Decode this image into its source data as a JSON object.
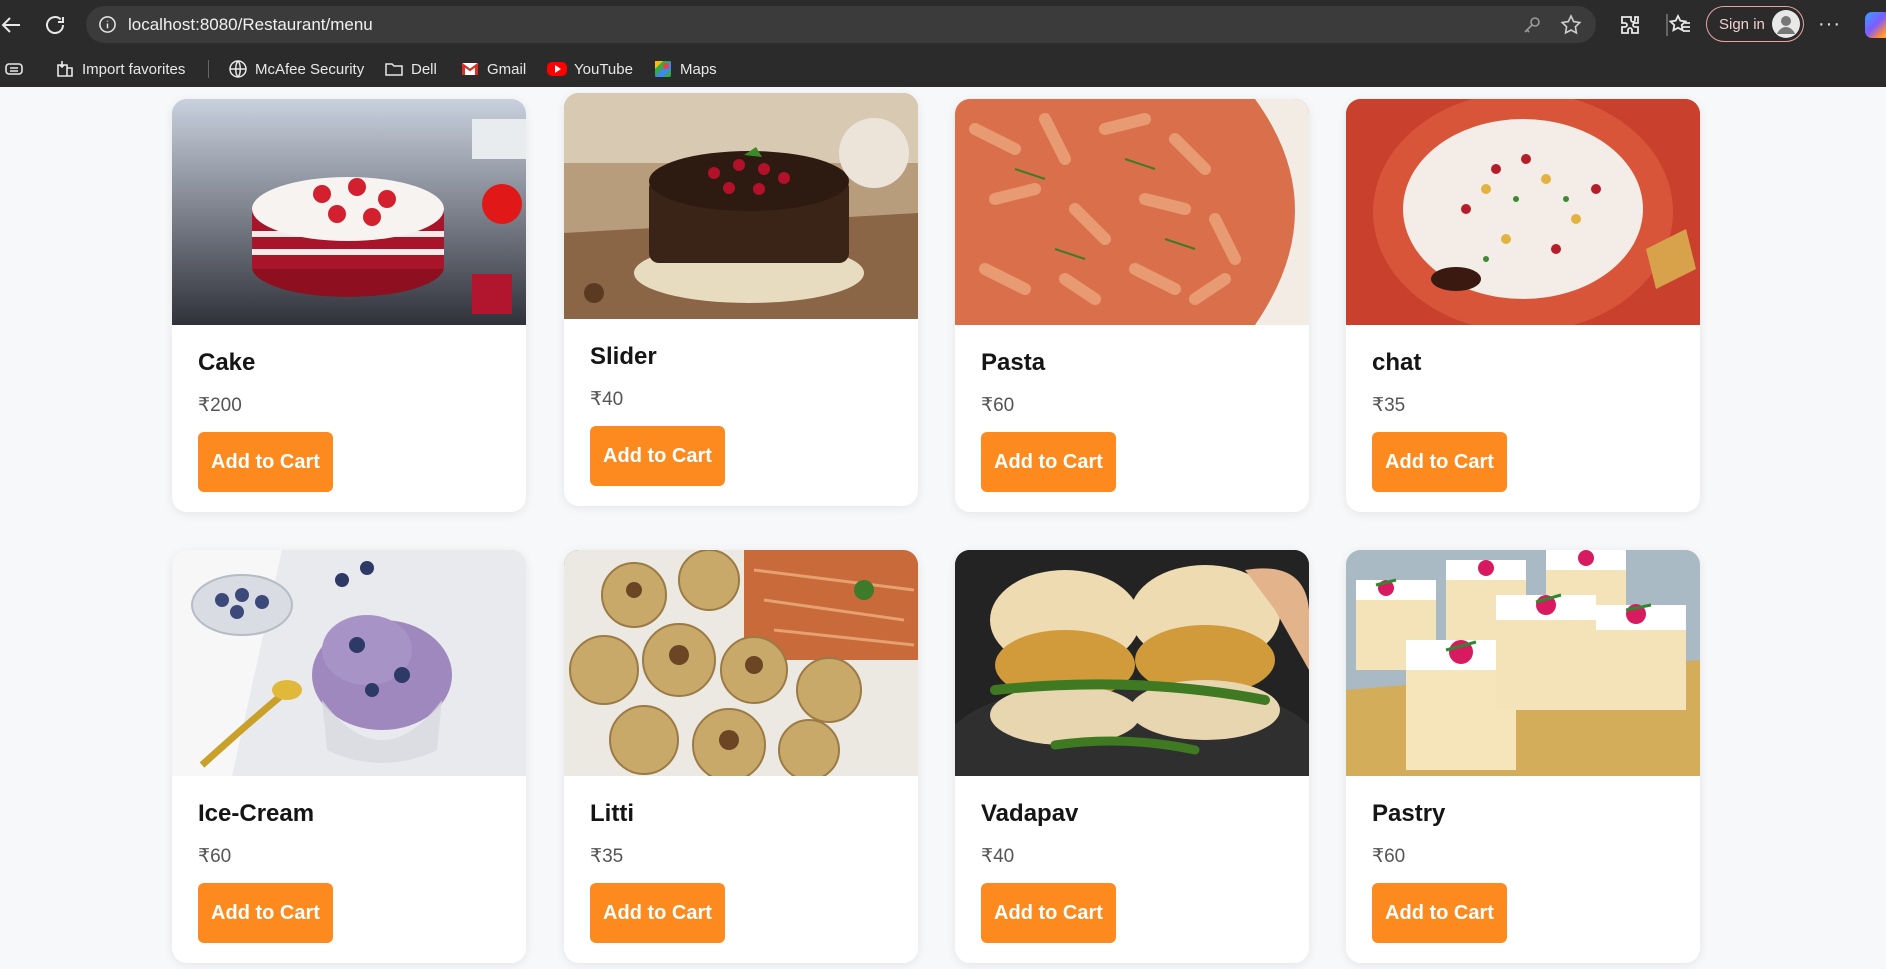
{
  "browser": {
    "url": "localhost:8080/Restaurant/menu",
    "signin_label": "Sign in",
    "more_label": "···",
    "bookmarks": [
      {
        "label": "Import favorites",
        "icon": "import-icon"
      },
      {
        "label": "McAfee Security",
        "icon": "globe-icon"
      },
      {
        "label": "Dell",
        "icon": "folder-icon"
      },
      {
        "label": "Gmail",
        "icon": "gmail-icon"
      },
      {
        "label": "YouTube",
        "icon": "youtube-icon"
      },
      {
        "label": "Maps",
        "icon": "maps-icon"
      }
    ]
  },
  "menu": {
    "button_label": "Add to Cart",
    "items": [
      {
        "name": "Cake",
        "price": "₹200"
      },
      {
        "name": "Slider",
        "price": "₹40"
      },
      {
        "name": "Pasta",
        "price": "₹60"
      },
      {
        "name": "chat",
        "price": "₹35"
      },
      {
        "name": "Ice-Cream",
        "price": "₹60"
      },
      {
        "name": "Litti",
        "price": "₹35"
      },
      {
        "name": "Vadapav",
        "price": "₹40"
      },
      {
        "name": "Pastry",
        "price": "₹60"
      }
    ]
  },
  "colors": {
    "button": "#fc8a1e",
    "chrome": "#2b2b2b",
    "page_bg": "#f7f8fa"
  }
}
